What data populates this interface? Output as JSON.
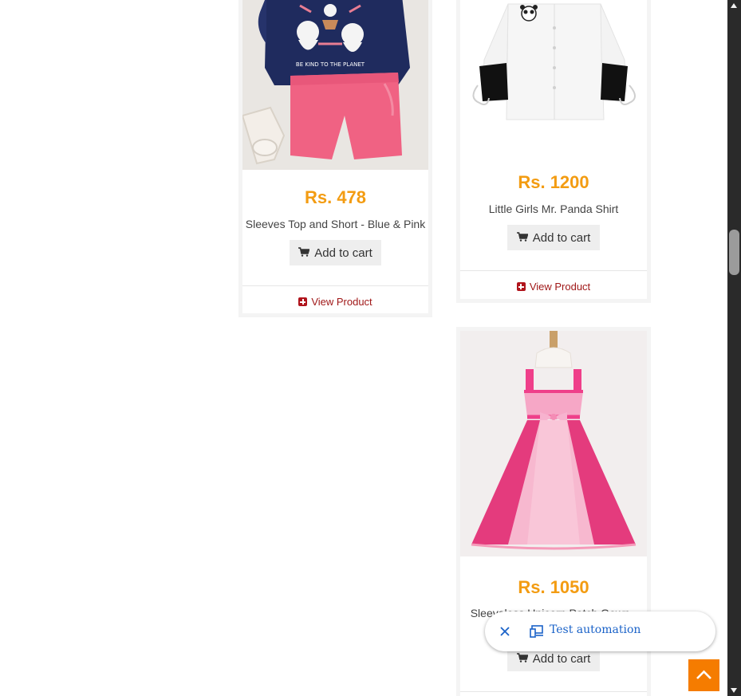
{
  "products": [
    {
      "price": "Rs. 478",
      "name": "Sleeves Top and Short - Blue & Pink",
      "add_to_cart": "Add to cart",
      "view_product": "View Product",
      "image_alt": "Blue top with cat print and pink shorts",
      "print_text": "BE KIND TO THE PLANET"
    },
    {
      "price": "Rs. 1200",
      "name": "Little Girls Mr. Panda Shirt",
      "add_to_cart": "Add to cart",
      "view_product": "View Product",
      "image_alt": "White shirt with panda patch and black cuffs"
    },
    {
      "price": "Rs. 1050",
      "name": "Sleeveless Unicorn Patch Gown -",
      "add_to_cart": "Add to cart",
      "image_alt": "Pink tulle unicorn gown on mannequin"
    }
  ],
  "floating_bar": {
    "label": "Test automation",
    "close_icon": "close-icon",
    "device_icon": "devices-icon"
  },
  "back_to_top": {
    "icon": "chevron-up-icon"
  },
  "colors": {
    "price": "#f39c12",
    "view_link": "#a01818",
    "back_to_top": "#f57c00",
    "pill_text": "#1a62c8"
  }
}
